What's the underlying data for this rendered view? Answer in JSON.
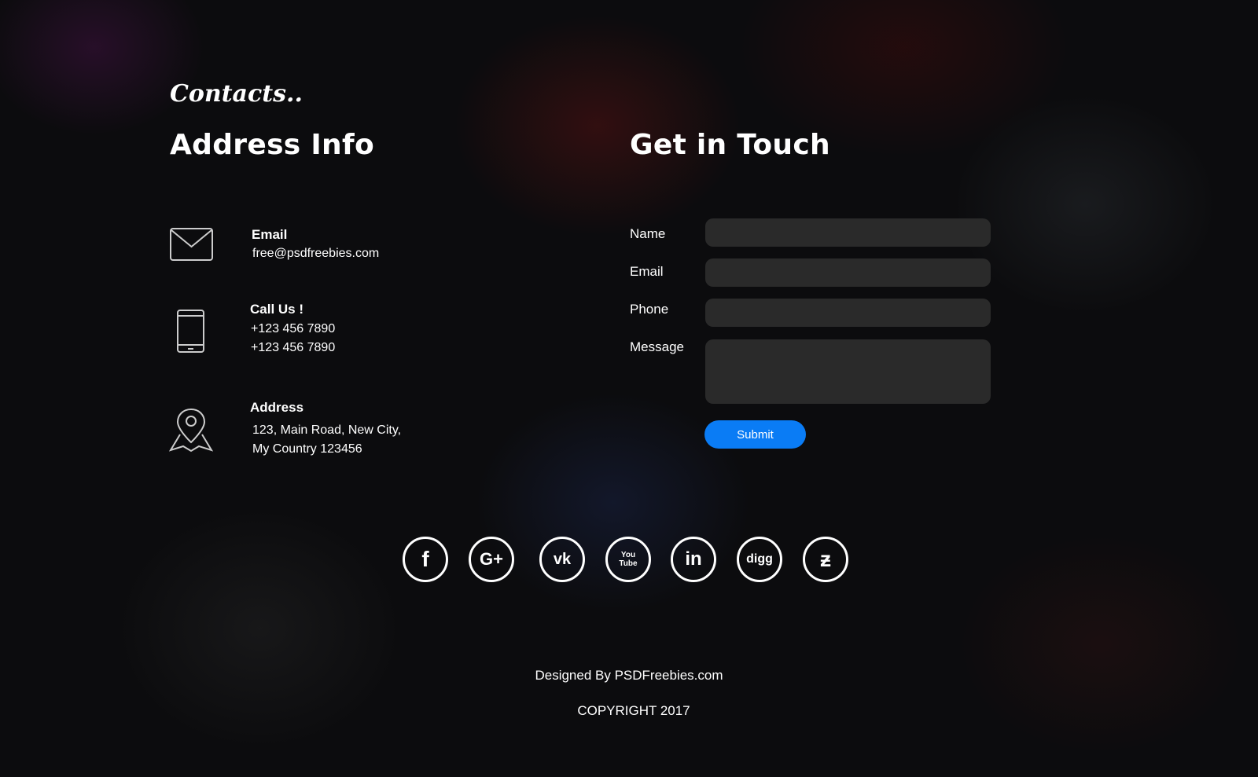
{
  "section_title": "Contacts..",
  "address": {
    "heading": "Address Info",
    "email": {
      "label": "Email",
      "value": "free@psdfreebies.com",
      "icon": "envelope-icon"
    },
    "phone": {
      "label": "Call Us !",
      "values": [
        "+123 456 7890",
        "+123 456 7890"
      ],
      "icon": "mobile-phone-icon"
    },
    "location": {
      "label": "Address",
      "lines": [
        "123, Main Road, New City,",
        "My Country 123456"
      ],
      "icon": "map-pin-icon"
    }
  },
  "form": {
    "heading": "Get in Touch",
    "labels": {
      "name": "Name",
      "email": "Email",
      "phone": "Phone",
      "message": "Message"
    },
    "submit_label": "Submit",
    "accent": "#0a7cf5"
  },
  "social": [
    {
      "name": "facebook",
      "glyph": "f"
    },
    {
      "name": "google-plus",
      "glyph": "G+"
    },
    {
      "name": "vk",
      "glyph": "vk"
    },
    {
      "name": "youtube",
      "glyph": "You Tube"
    },
    {
      "name": "linkedin",
      "glyph": "in"
    },
    {
      "name": "digg",
      "glyph": "digg"
    },
    {
      "name": "deviantart",
      "glyph": "ƶ"
    }
  ],
  "footer": {
    "designed_by": "Designed By PSDFreebies.com",
    "copyright": "COPYRIGHT 2017"
  }
}
